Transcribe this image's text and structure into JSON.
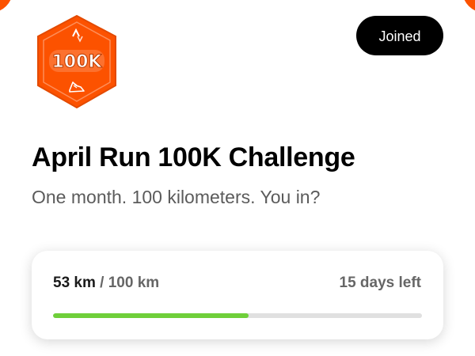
{
  "badge": {
    "label": "100K",
    "icon": "running-shoe-icon",
    "color": "#fc5200"
  },
  "header": {
    "joined_label": "Joined"
  },
  "challenge": {
    "title": "April Run 100K Challenge",
    "subtitle": "One month. 100 kilometers. You in?"
  },
  "progress": {
    "current": "53 km",
    "separator": "/",
    "goal": "100 km",
    "days_left": "15 days left",
    "fraction": 0.53,
    "fill_color": "#6fcf3a"
  },
  "accent_color": "#fc5200"
}
